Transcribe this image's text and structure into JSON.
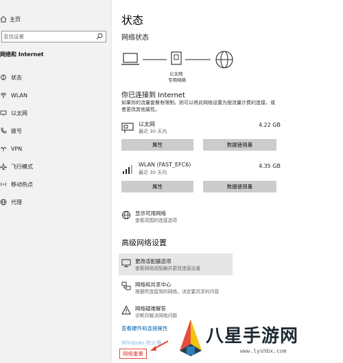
{
  "sidebar": {
    "home_label": "主页",
    "search_placeholder": "查找设置",
    "section_title": "网络和 Internet",
    "items": [
      {
        "label": "状态",
        "icon": "status-icon"
      },
      {
        "label": "WLAN",
        "icon": "wifi-icon"
      },
      {
        "label": "以太网",
        "icon": "ethernet-icon"
      },
      {
        "label": "拨号",
        "icon": "phone-icon"
      },
      {
        "label": "VPN",
        "icon": "vpn-icon"
      },
      {
        "label": "飞行模式",
        "icon": "airplane-icon"
      },
      {
        "label": "移动热点",
        "icon": "hotspot-icon"
      },
      {
        "label": "代理",
        "icon": "globe-icon"
      }
    ]
  },
  "main": {
    "title": "状态",
    "network_status_heading": "网络状态",
    "diagram_label_line1": "以太网",
    "diagram_label_line2": "专用网络",
    "connected_title": "你已连接到 Internet",
    "connected_desc": "如果你的流量套餐有限制，则可以将此网络设置为按流量计费的连接，或者更改其他属性。",
    "adapters": [
      {
        "name": "以太网",
        "sub": "最近 30 天内",
        "size": "4.22 GB",
        "props_label": "属性",
        "usage_label": "数据使用量"
      },
      {
        "name": "WLAN (FAST_EFC6)",
        "sub": "最近 30 天内",
        "size": "4.35 GB",
        "props_label": "属性",
        "usage_label": "数据使用量"
      }
    ],
    "show_networks": {
      "title": "显示可用网络",
      "desc": "查看周围的连接选项"
    },
    "advanced_heading": "高级网络设置",
    "advanced_items": [
      {
        "title": "更改适配器选项",
        "desc": "查看网络适配器并更改连接设置"
      },
      {
        "title": "网络和共享中心",
        "desc": "根据所连接到的网络，决定要共享的内容"
      },
      {
        "title": "网络疑难解答",
        "desc": "诊断并解决网络问题"
      }
    ],
    "hardware_link": "查看硬件和连接属性",
    "firewall_link": "Windows 防火墙",
    "reset_link": "网络重置"
  },
  "watermark": {
    "text": "八星手游网",
    "url": "www.lyshbx.com"
  },
  "colors": {
    "accent_link": "#0063b1",
    "highlight_box": "#e0463a",
    "sidebar_bg": "#f2f2f2"
  }
}
